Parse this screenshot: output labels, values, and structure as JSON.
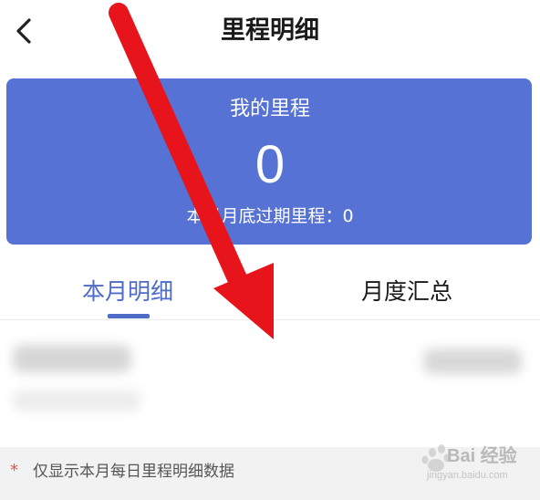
{
  "header": {
    "title": "里程明细",
    "back_icon": "chevron-left-icon"
  },
  "card": {
    "title": "我的里程",
    "value": "0",
    "expire_label": "本月月底过期里程：0",
    "background_color": "#5572d4"
  },
  "tabs": [
    {
      "label": "本月明细",
      "selected": true
    },
    {
      "label": "月度汇总",
      "selected": false
    }
  ],
  "accent_color": "#4f6bc8",
  "footer": {
    "star": "*",
    "note": "仅显示本月每日里程明细数据"
  },
  "watermark": {
    "brand": "Bai 经验",
    "sub": "jingyan.baidu.com"
  },
  "annotation": {
    "arrow_color": "#e8141c"
  }
}
